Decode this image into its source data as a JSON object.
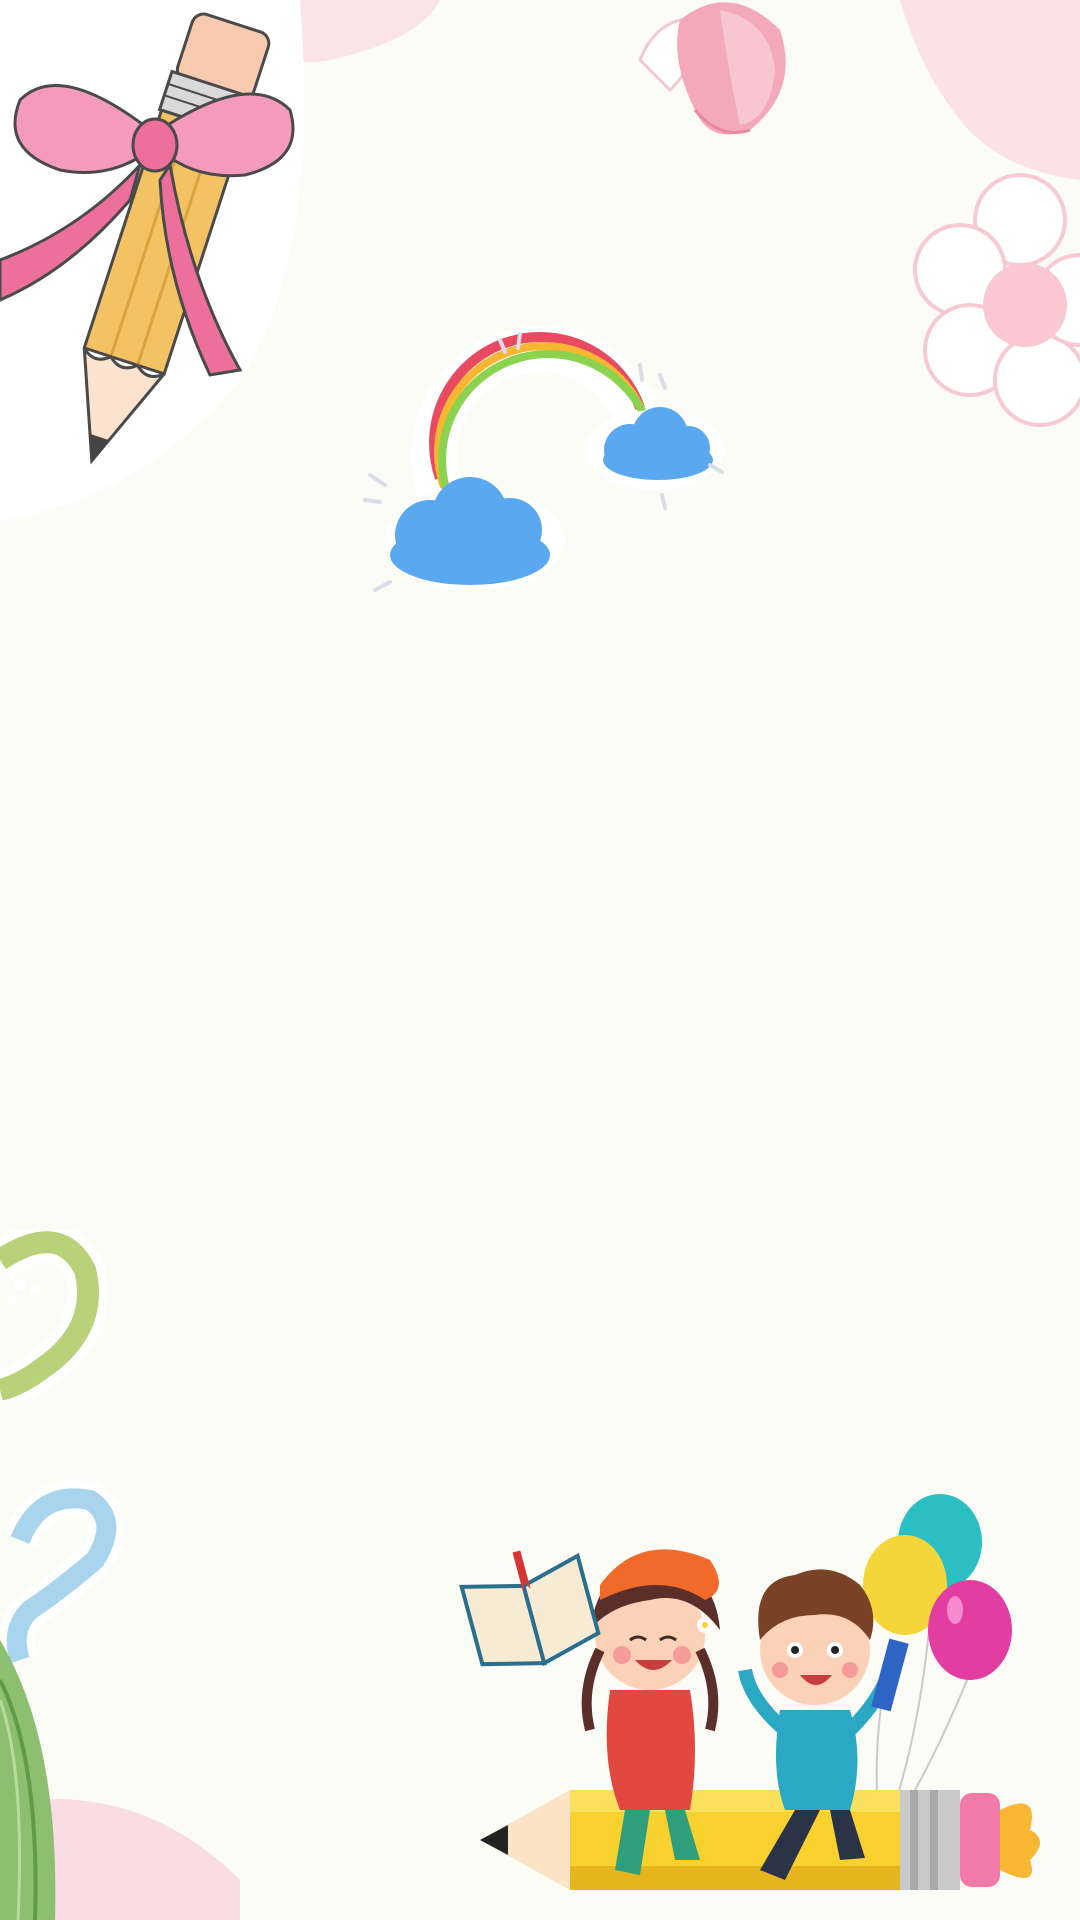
{
  "background": {
    "color": "#fcfcf6"
  },
  "decorations": [
    {
      "name": "pink-blob-icon",
      "color": "#fadde4"
    },
    {
      "name": "tulip-flower-icon",
      "color": "#f4a9b8"
    },
    {
      "name": "pencil-with-bow-icon",
      "color": "#f0c45a"
    },
    {
      "name": "pink-flower-icon",
      "color": "#f7c9d2"
    },
    {
      "name": "rainbow-clouds-icon",
      "color": "#5aa9f0"
    },
    {
      "name": "green-swirl-icon",
      "color": "#a8c86a"
    },
    {
      "name": "blue-swirl-icon",
      "color": "#a8d4ee"
    },
    {
      "name": "green-leaf-icon",
      "color": "#8cc070"
    },
    {
      "name": "kids-on-pencil-icon",
      "color": "#f5d23a"
    },
    {
      "name": "balloons-icon",
      "color": "#e23da0"
    }
  ]
}
